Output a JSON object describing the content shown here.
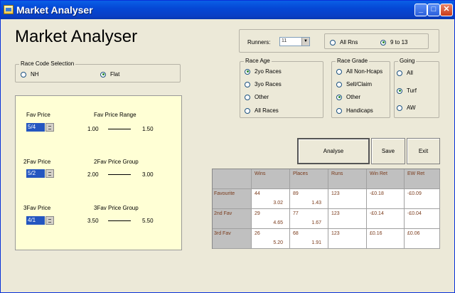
{
  "window": {
    "title": "Market Analyser"
  },
  "app_heading": "Market Analyser",
  "runners": {
    "label": "Runners:",
    "value": "11",
    "options": [
      {
        "label": "All Rns",
        "checked": false
      },
      {
        "label": "9 to 13",
        "checked": true
      }
    ]
  },
  "race_code": {
    "legend": "Race Code Selection",
    "options": [
      {
        "label": "NH",
        "checked": false
      },
      {
        "label": "Flat",
        "checked": true
      }
    ]
  },
  "race_age": {
    "legend": "Race Age",
    "options": [
      {
        "label": "2yo Races",
        "checked": true
      },
      {
        "label": "3yo Races",
        "checked": false
      },
      {
        "label": "Other",
        "checked": false
      },
      {
        "label": "All Races",
        "checked": false
      }
    ]
  },
  "race_grade": {
    "legend": "Race Grade",
    "options": [
      {
        "label": "All Non-Hcaps",
        "checked": false
      },
      {
        "label": "Sell/Claim",
        "checked": false
      },
      {
        "label": "Other",
        "checked": true
      },
      {
        "label": "Handicaps",
        "checked": false
      }
    ]
  },
  "going": {
    "legend": "Going",
    "options": [
      {
        "label": "All",
        "checked": false
      },
      {
        "label": "Turf",
        "checked": true
      },
      {
        "label": "AW",
        "checked": false
      }
    ]
  },
  "prices": {
    "fav_price_label": "Fav Price",
    "fav_price_value": "5/4",
    "fav_range_label": "Fav Price Range",
    "fav_range_low": "1.00",
    "fav_range_high": "1.50",
    "fav2_price_label": "2Fav Price",
    "fav2_price_value": "5/2",
    "fav2_group_label": "2Fav Price Group",
    "fav2_group_low": "2.00",
    "fav2_group_high": "3.00",
    "fav3_price_label": "3Fav Price",
    "fav3_price_value": "4/1",
    "fav3_group_label": "3Fav Price Group",
    "fav3_group_low": "3.50",
    "fav3_group_high": "5.50"
  },
  "buttons": {
    "analyse": "Analyse",
    "save": "Save",
    "exit": "Exit"
  },
  "results": {
    "columns": [
      "Wins",
      "Places",
      "Runs",
      "Win Ret",
      "EW Ret"
    ],
    "rows": [
      {
        "label": "Favourite",
        "wins": "44",
        "wins_sub": "3.02",
        "places": "89",
        "places_sub": "1.43",
        "runs": "123",
        "win_ret": "-£0.18",
        "ew_ret": "-£0.09"
      },
      {
        "label": "2nd Fav",
        "wins": "29",
        "wins_sub": "4.65",
        "places": "77",
        "places_sub": "1.67",
        "runs": "123",
        "win_ret": "-£0.14",
        "ew_ret": "-£0.04"
      },
      {
        "label": "3rd Fav",
        "wins": "26",
        "wins_sub": "5.20",
        "places": "68",
        "places_sub": "1.91",
        "runs": "123",
        "win_ret": "£0.16",
        "ew_ret": "£0.06"
      }
    ]
  }
}
